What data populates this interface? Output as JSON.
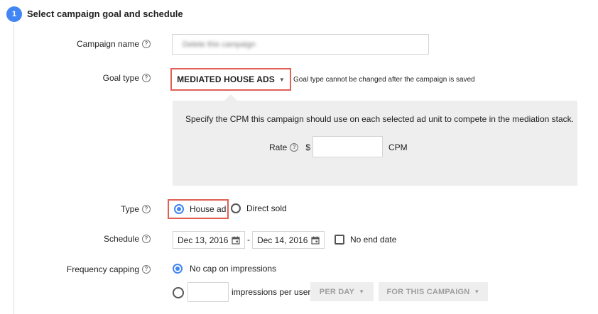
{
  "step": {
    "number": "1",
    "title": "Select campaign goal and schedule"
  },
  "campaign_name": {
    "label": "Campaign name",
    "value": "Delete this campaign"
  },
  "goal_type": {
    "label": "Goal type",
    "selected": "MEDIATED HOUSE ADS",
    "note": "Goal type cannot be changed after the campaign is saved"
  },
  "cpm_panel": {
    "description": "Specify the CPM this campaign should use on each selected ad unit to compete in the mediation stack.",
    "rate_label": "Rate",
    "currency": "$",
    "rate_value": "",
    "unit": "CPM"
  },
  "type": {
    "label": "Type",
    "options": [
      {
        "label": "House ad",
        "selected": true
      },
      {
        "label": "Direct sold",
        "selected": false
      }
    ]
  },
  "schedule": {
    "label": "Schedule",
    "start": "Dec 13, 2016",
    "separator": "-",
    "end": "Dec 14, 2016",
    "no_end_label": "No end date",
    "no_end_checked": false
  },
  "frequency": {
    "label": "Frequency capping",
    "no_cap_label": "No cap on impressions",
    "no_cap_selected": true,
    "cap_value": "",
    "cap_suffix": "impressions per user",
    "period": "PER DAY",
    "scope": "FOR THIS CAMPAIGN"
  },
  "colors": {
    "accent": "#4285f4",
    "highlight": "#e06055",
    "panel": "#eeeeee"
  }
}
